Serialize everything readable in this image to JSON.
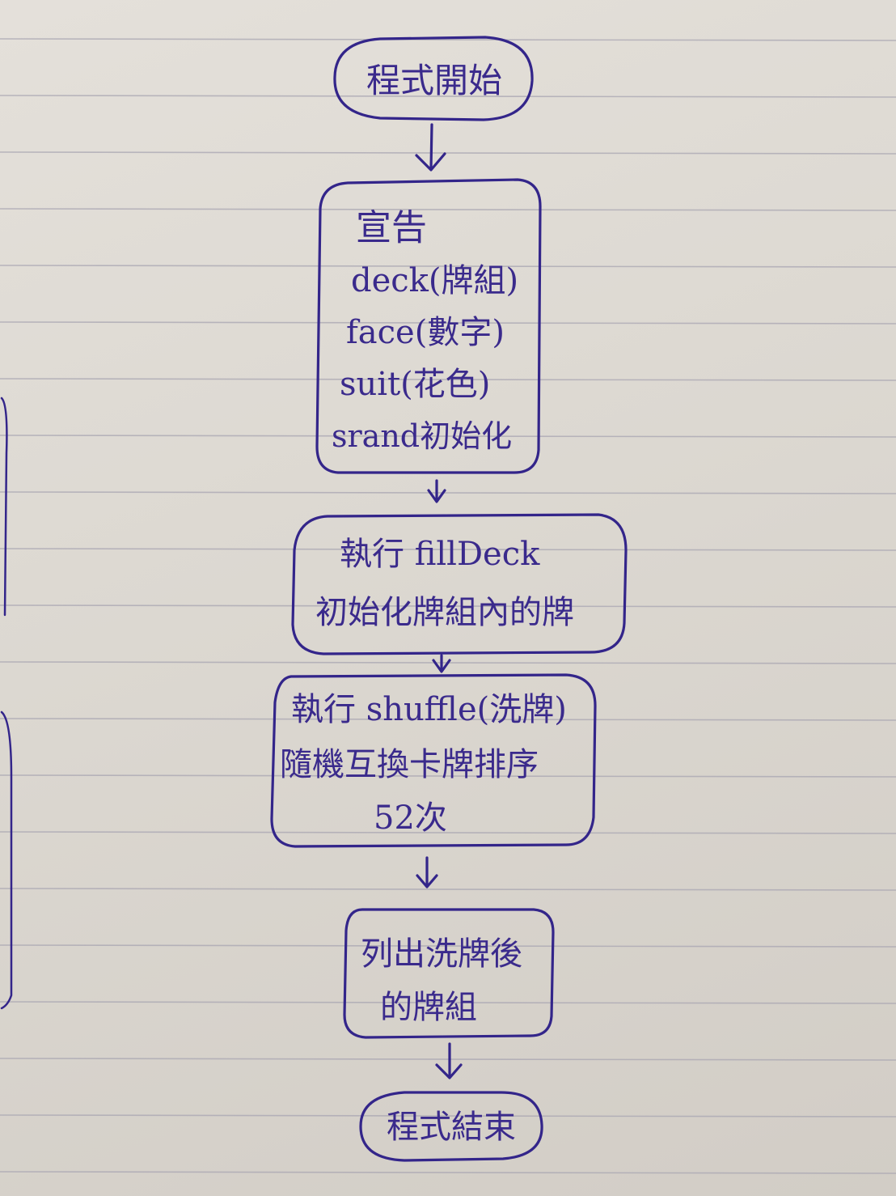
{
  "flowchart": {
    "start": "程式開始",
    "declare": {
      "lines": [
        "宣告",
        "deck(牌組)",
        "face(數字)",
        "suit(花色)",
        "srand初始化"
      ]
    },
    "fill_deck": {
      "lines": [
        "執行 fillDeck",
        "初始化牌組內的牌"
      ]
    },
    "shuffle": {
      "lines": [
        "執行 shuffle(洗牌)",
        "隨機互換卡牌排序",
        "52次"
      ]
    },
    "print": {
      "lines": [
        "列出洗牌後",
        "的牌組"
      ]
    },
    "end": "程式結束"
  },
  "colors": {
    "ink": "#33258a",
    "paper": "#dedad3",
    "rule_line": "#a9a6b2"
  }
}
